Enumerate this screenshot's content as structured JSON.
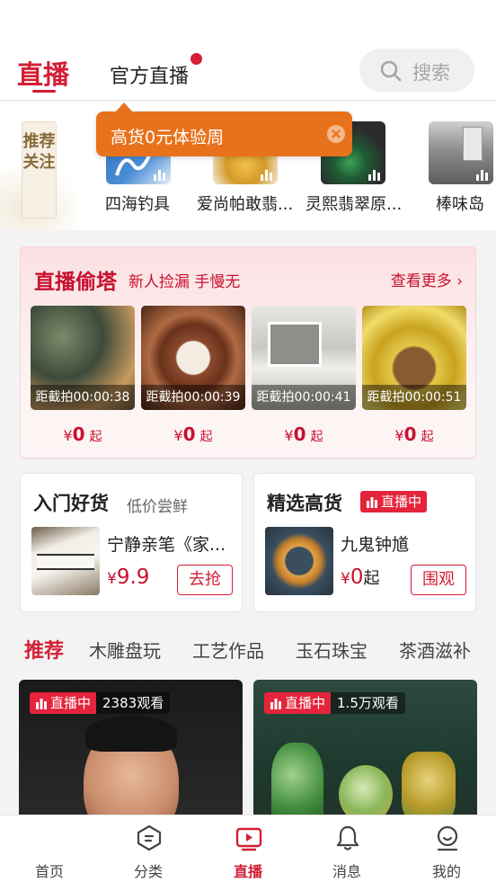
{
  "header": {
    "tabs": [
      {
        "label": "直播",
        "active": true
      },
      {
        "label": "官方直播",
        "active": false
      }
    ],
    "search_label": "搜索"
  },
  "follow": {
    "badge": "推荐关注",
    "items": [
      {
        "name": "四海钓具"
      },
      {
        "name": "爱尚帕敢翡..."
      },
      {
        "name": "灵熙翡翠原..."
      },
      {
        "name": "棒味岛"
      }
    ]
  },
  "tooltip": {
    "text": "高货0元体验周"
  },
  "sneak": {
    "title": "直播偷塔",
    "subtitle": "新人捡漏 手慢无",
    "more": "查看更多 ›",
    "items": [
      {
        "countdown": "距截拍00:00:38",
        "currency": "¥",
        "price": "0",
        "suffix": "起"
      },
      {
        "countdown": "距截拍00:00:39",
        "currency": "¥",
        "price": "0",
        "suffix": "起"
      },
      {
        "countdown": "距截拍00:00:41",
        "currency": "¥",
        "price": "0",
        "suffix": "起"
      },
      {
        "countdown": "距截拍00:00:51",
        "currency": "¥",
        "price": "0",
        "suffix": "起"
      }
    ]
  },
  "cards": {
    "left": {
      "title": "入门好货",
      "subtitle": "低价尝鲜",
      "product": "宁静亲笔《家...",
      "currency": "¥",
      "price": "9.9",
      "button": "去抢"
    },
    "right": {
      "title": "精选高货",
      "badge": "直播中",
      "product": "九鬼钟馗",
      "currency": "¥",
      "price": "0",
      "suffix": "起",
      "button": "围观"
    }
  },
  "categories": [
    "推荐",
    "木雕盘玩",
    "工艺作品",
    "玉石珠宝",
    "茶酒滋补"
  ],
  "streams": [
    {
      "status": "直播中",
      "viewers": "2383观看"
    },
    {
      "status": "直播中",
      "viewers": "1.5万观看"
    }
  ],
  "bottom_nav": [
    {
      "label": "首页",
      "icon": "home-icon",
      "active": false
    },
    {
      "label": "分类",
      "icon": "category-icon",
      "active": false
    },
    {
      "label": "直播",
      "icon": "live-tv-icon",
      "active": true
    },
    {
      "label": "消息",
      "icon": "bell-icon",
      "active": false
    },
    {
      "label": "我的",
      "icon": "profile-icon",
      "active": false
    }
  ],
  "colors": {
    "accent": "#d41e35",
    "tooltip": "#e8721c",
    "live_badge": "#e4243b"
  }
}
